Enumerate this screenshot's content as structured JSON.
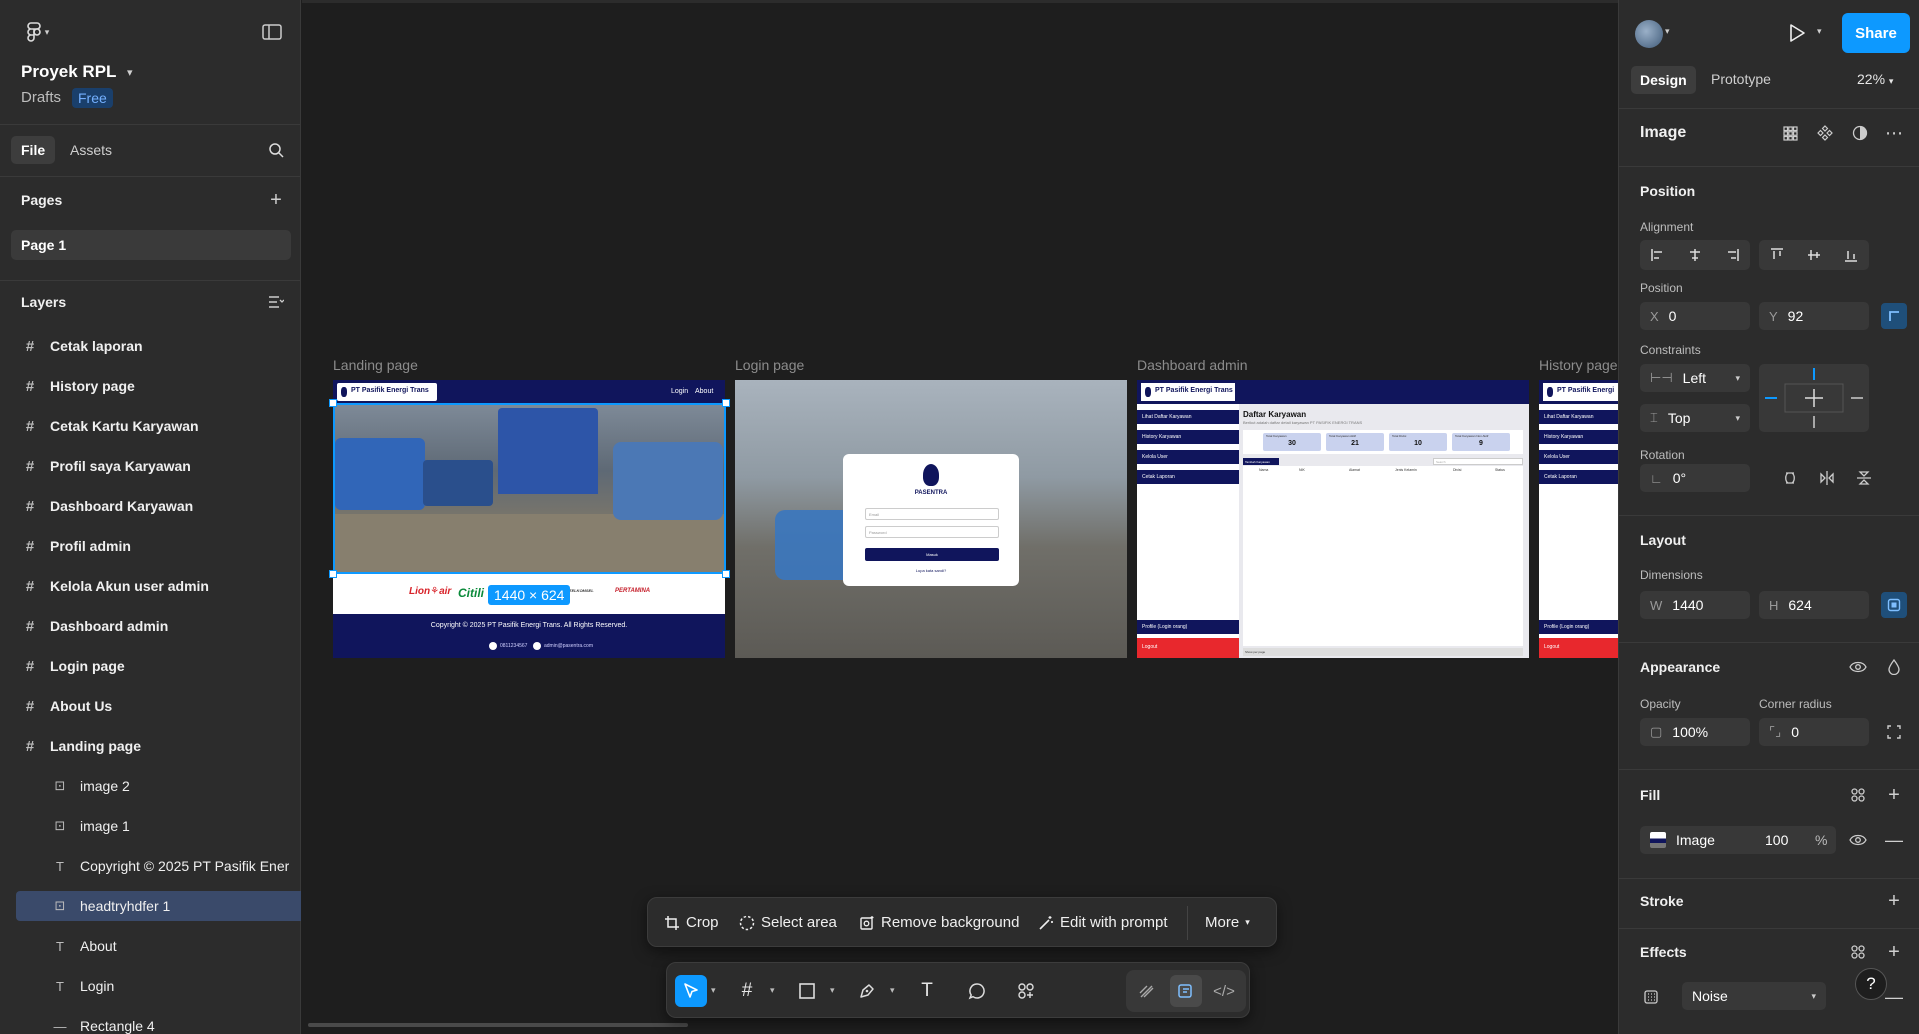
{
  "project": {
    "title": "Proyek RPL",
    "location": "Drafts",
    "plan_badge": "Free"
  },
  "left_tabs": {
    "file": "File",
    "assets": "Assets"
  },
  "pages": {
    "title": "Pages",
    "items": [
      "Page 1"
    ]
  },
  "layers": {
    "title": "Layers",
    "items": [
      {
        "label": "Cetak laporan",
        "type": "frame"
      },
      {
        "label": "History page",
        "type": "frame"
      },
      {
        "label": "Cetak Kartu Karyawan",
        "type": "frame"
      },
      {
        "label": "Profil saya Karyawan",
        "type": "frame"
      },
      {
        "label": "Dashboard Karyawan",
        "type": "frame"
      },
      {
        "label": "Profil admin",
        "type": "frame"
      },
      {
        "label": "Kelola Akun user admin",
        "type": "frame"
      },
      {
        "label": "Dashboard admin",
        "type": "frame"
      },
      {
        "label": "Login page",
        "type": "frame"
      },
      {
        "label": "About Us",
        "type": "frame"
      },
      {
        "label": "Landing page",
        "type": "frame"
      },
      {
        "label": "image 2",
        "type": "image"
      },
      {
        "label": "image 1",
        "type": "image"
      },
      {
        "label": "Copyright © 2025 PT Pasifik Ener",
        "type": "text"
      },
      {
        "label": "headtryhdfer 1",
        "type": "image",
        "selected": true
      },
      {
        "label": "About",
        "type": "text"
      },
      {
        "label": "Login",
        "type": "text"
      },
      {
        "label": "Rectangle 4",
        "type": "rect"
      }
    ]
  },
  "canvas": {
    "frames": [
      {
        "label": "Landing page"
      },
      {
        "label": "Login page"
      },
      {
        "label": "Dashboard admin"
      },
      {
        "label": "History page"
      }
    ],
    "selection_size": "1440 × 624",
    "landing": {
      "logo": "PT Pasifik Energi Trans",
      "nav_login": "Login",
      "nav_about": "About",
      "partners": [
        "Lion⚘air",
        "Citili",
        "TELKOMSEL",
        "PERTAMINA"
      ],
      "copyright": "Copyright © 2025 PT Pasifik Energi Trans. All Rights Reserved.",
      "phone": "0811234567",
      "email": "admin@pasentra.com"
    },
    "login": {
      "brand": "PASENTRA",
      "email_placeholder": "Email",
      "password_placeholder": "Password",
      "button": "Masuk",
      "forgot": "Lupa kata sandi?"
    },
    "dashboard": {
      "logo": "PT Pasifik Energi Trans",
      "menu": [
        "Lihat Daftar Karyawan",
        "History Karyawan",
        "Kelola User",
        "Cetak Laporan"
      ],
      "profile": "Profile (Login orang)",
      "logout": "Logout",
      "title": "Daftar Karyawan",
      "subtitle": "Berikut adalah daftar detail karyawan PT PASIFIK ENERGI TRANS",
      "stats": [
        {
          "label": "Total Karyawan",
          "value": "30"
        },
        {
          "label": "Total Karyawan Aktif",
          "value": "21"
        },
        {
          "label": "Total Divisi",
          "value": "10"
        },
        {
          "label": "Total Karyawan Non Aktif",
          "value": "9"
        }
      ],
      "add_button": "Tambah Karyawan",
      "search_placeholder": "Search",
      "columns": [
        "Nama",
        "NIK",
        "Alamat",
        "Jenis Kelamin",
        "Divisi",
        "Status"
      ],
      "footer": "Show per page"
    },
    "history": {
      "logo": "PT Pasifik Energi",
      "menu": [
        "Lihat Daftar Karyawan",
        "History Karyawan",
        "Kelola User",
        "Cetak Laporan"
      ],
      "profile": "Profile (Login orang)",
      "logout": "Logout"
    }
  },
  "context_toolbar": {
    "crop": "Crop",
    "select_area": "Select area",
    "remove_bg": "Remove background",
    "edit_prompt": "Edit with prompt",
    "more": "More"
  },
  "right_panel": {
    "share": "Share",
    "tabs": {
      "design": "Design",
      "prototype": "Prototype"
    },
    "zoom": "22%",
    "layer_type": "Image",
    "position": {
      "title": "Position",
      "alignment_label": "Alignment",
      "position_label": "Position",
      "x_label": "X",
      "x": "0",
      "y_label": "Y",
      "y": "92",
      "constraints_label": "Constraints",
      "h_constraint": "Left",
      "v_constraint": "Top",
      "rotation_label": "Rotation",
      "rotation": "0°"
    },
    "layout": {
      "title": "Layout",
      "dimensions_label": "Dimensions",
      "w_label": "W",
      "w": "1440",
      "h_label": "H",
      "h": "624"
    },
    "appearance": {
      "title": "Appearance",
      "opacity_label": "Opacity",
      "opacity": "100%",
      "radius_label": "Corner radius",
      "radius": "0"
    },
    "fill": {
      "title": "Fill",
      "type": "Image",
      "opacity": "100",
      "unit": "%"
    },
    "stroke": {
      "title": "Stroke"
    },
    "effects": {
      "title": "Effects",
      "effect": "Noise"
    },
    "help": "?"
  },
  "colors": {
    "accent": "#0d99ff",
    "panel": "#2c2c2c",
    "canvas": "#1e1e1e",
    "brand_navy": "#10155c"
  }
}
